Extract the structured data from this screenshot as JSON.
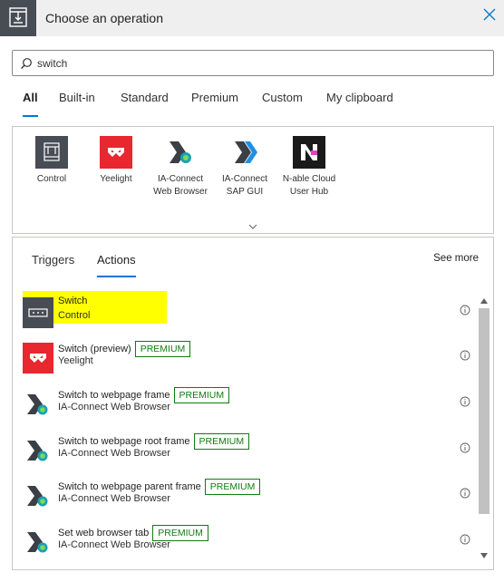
{
  "header": {
    "title": "Choose an operation"
  },
  "search": {
    "value": "switch"
  },
  "tabs": [
    {
      "label": "All",
      "active": true
    },
    {
      "label": "Built-in"
    },
    {
      "label": "Standard"
    },
    {
      "label": "Premium"
    },
    {
      "label": "Custom"
    },
    {
      "label": "My clipboard"
    }
  ],
  "connectors": [
    {
      "name": "Control",
      "icon": "control-icon",
      "color": "#474c55"
    },
    {
      "name": "Yeelight",
      "icon": "yeelight-icon",
      "color": "#e8272f"
    },
    {
      "name": "IA-Connect Web Browser",
      "name_line1": "IA-Connect",
      "name_line2": "Web Browser",
      "icon": "ia-connect-web-browser-icon"
    },
    {
      "name": "IA-Connect SAP GUI",
      "name_line1": "IA-Connect",
      "name_line2": "SAP GUI",
      "icon": "ia-connect-sap-gui-icon"
    },
    {
      "name": "N-able Cloud User Hub",
      "name_line1": "N-able Cloud",
      "name_line2": "User Hub",
      "icon": "n-able-icon",
      "color": "#1a1a1a"
    }
  ],
  "results": {
    "tabs": [
      {
        "label": "Triggers"
      },
      {
        "label": "Actions",
        "active": true
      }
    ],
    "see_more": "See more",
    "actions": [
      {
        "title": "Switch",
        "connector": "Control",
        "premium": "",
        "highlighted": true
      },
      {
        "title": "Switch (preview)",
        "connector": "Yeelight",
        "premium": "PREMIUM"
      },
      {
        "title": "Switch to webpage frame",
        "connector": "IA-Connect Web Browser",
        "premium": "PREMIUM"
      },
      {
        "title": "Switch to webpage root frame",
        "connector": "IA-Connect Web Browser",
        "premium": "PREMIUM"
      },
      {
        "title": "Switch to webpage parent frame",
        "connector": "IA-Connect Web Browser",
        "premium": "PREMIUM"
      },
      {
        "title": "Set web browser tab",
        "connector": "IA-Connect Web Browser",
        "premium": "PREMIUM"
      }
    ]
  },
  "colors": {
    "accent": "#0078d4",
    "premium": "#107c10",
    "highlight": "#ffff00"
  }
}
